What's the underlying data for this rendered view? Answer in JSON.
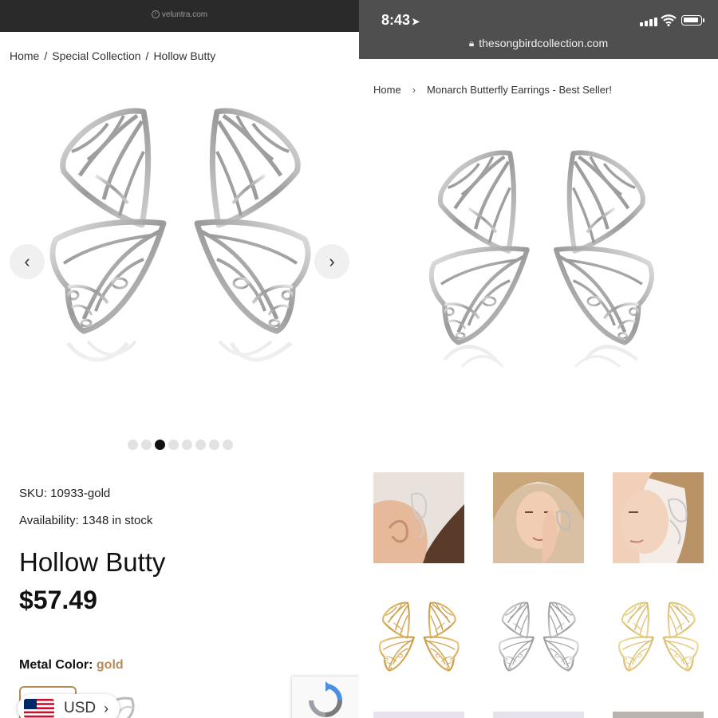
{
  "left": {
    "url": "veluntra.com",
    "breadcrumb": [
      "Home",
      "Special Collection",
      "Hollow Butty"
    ],
    "breadcrumb_sep": "/",
    "carousel": {
      "total_dots": 8,
      "active_index": 2
    },
    "sku": "SKU: 10933-gold",
    "availability": "Availability: 1348 in stock",
    "title": "Hollow Butty",
    "price": "$57.49",
    "metal_label": "Metal Color:",
    "metal_value": "gold",
    "currency": "USD",
    "colors": {
      "gold": "#b58b5a",
      "urlbar": "#2a2a2a"
    }
  },
  "right": {
    "time": "8:43",
    "url": "thesongbirdcollection.com",
    "breadcrumb_home": "Home",
    "breadcrumb_sep": "›",
    "breadcrumb_current": "Monarch Butterfly Earrings - Best Seller!",
    "thumbnails": [
      {
        "name": "thumb-model-ear-closeup",
        "kind": "photo"
      },
      {
        "name": "thumb-model-hand-face",
        "kind": "photo"
      },
      {
        "name": "thumb-model-profile",
        "kind": "photo"
      },
      {
        "name": "thumb-gold-earrings",
        "kind": "product",
        "tone": "gold"
      },
      {
        "name": "thumb-silver-earrings",
        "kind": "product",
        "tone": "silver"
      },
      {
        "name": "thumb-gold-light-earrings",
        "kind": "product",
        "tone": "lightgold"
      }
    ],
    "colors": {
      "statusbar": "#4f4f4f"
    }
  }
}
